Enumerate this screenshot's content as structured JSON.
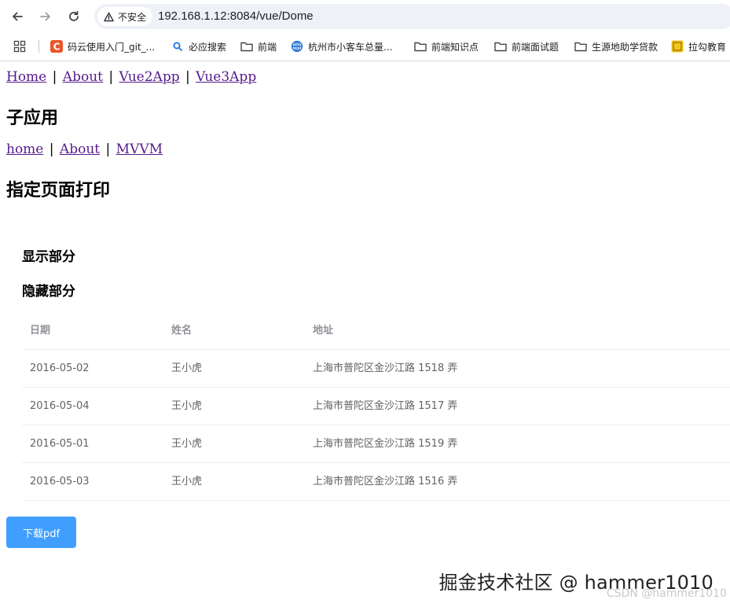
{
  "browser": {
    "security_label": "不安全",
    "url": "192.168.1.12:8084/vue/Dome",
    "bookmarks": [
      {
        "icon": "gitcode-icon",
        "color": "#e8562a",
        "label": "码云使用入门_git_..."
      },
      {
        "icon": "search-icon",
        "color": "#1a73e8",
        "label": "必应搜索"
      },
      {
        "icon": "folder-icon",
        "label": "前端"
      },
      {
        "icon": "globe-icon",
        "color": "#1f6fd1",
        "label": "杭州市小客车总量..."
      },
      {
        "icon": "folder-icon",
        "label": "前端知识点"
      },
      {
        "icon": "folder-icon",
        "label": "前端面试题"
      },
      {
        "icon": "folder-icon",
        "label": "生源地助学贷款"
      },
      {
        "icon": "lagou-icon",
        "color": "#f5c518",
        "label": "拉勾教育"
      }
    ]
  },
  "page": {
    "main_nav": [
      "Home",
      "About",
      "Vue2App",
      "Vue3App"
    ],
    "sub_app_title": "子应用",
    "sub_nav": [
      "home",
      "About",
      "MVVM"
    ],
    "print_title": "指定页面打印",
    "show_section": "显示部分",
    "hidden_section": "隐藏部分",
    "table": {
      "headers": [
        "日期",
        "姓名",
        "地址"
      ],
      "rows": [
        [
          "2016-05-02",
          "王小虎",
          "上海市普陀区金沙江路 1518 弄"
        ],
        [
          "2016-05-04",
          "王小虎",
          "上海市普陀区金沙江路 1517 弄"
        ],
        [
          "2016-05-01",
          "王小虎",
          "上海市普陀区金沙江路 1519 弄"
        ],
        [
          "2016-05-03",
          "王小虎",
          "上海市普陀区金沙江路 1516 弄"
        ]
      ]
    },
    "download_button": "下载pdf",
    "accent_color": "#409eff"
  },
  "watermark": {
    "primary": "掘金技术社区 @ hammer1010",
    "secondary": "CSDN @hammer1010"
  }
}
